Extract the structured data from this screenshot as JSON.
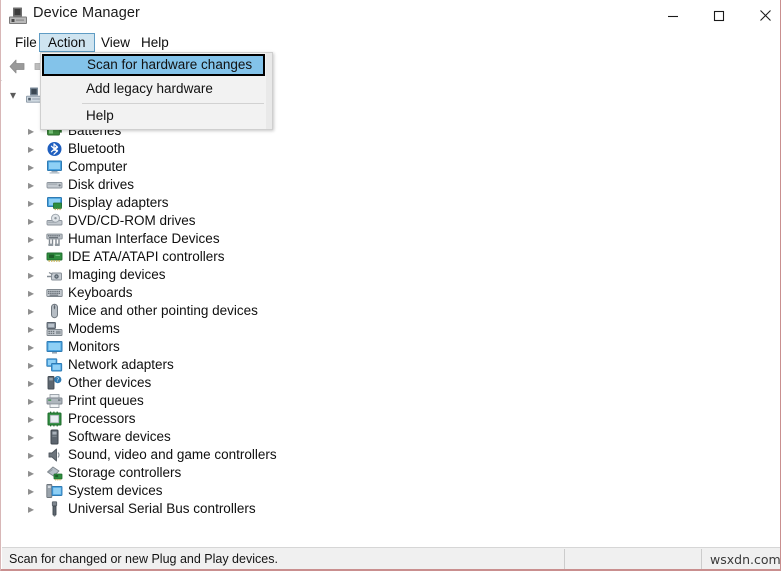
{
  "window": {
    "title": "Device Manager",
    "icon": "device-manager-icon",
    "controls": {
      "minimize": "—",
      "maximize": "☐",
      "close": "✕"
    }
  },
  "menubar": {
    "items": [
      {
        "label": "File",
        "active": false
      },
      {
        "label": "Action",
        "active": true
      },
      {
        "label": "View",
        "active": false
      },
      {
        "label": "Help",
        "active": false
      }
    ]
  },
  "toolbar": {
    "back_icon": "back-arrow-icon",
    "forward_icon": "forward-arrow-icon"
  },
  "action_menu": {
    "items": [
      {
        "label": "Scan for hardware changes",
        "highlighted": true
      },
      {
        "label": "Add legacy hardware",
        "highlighted": false
      },
      {
        "label": "Help",
        "highlighted": false
      }
    ],
    "highlight_color": "#83c3ea",
    "background_color": "#f2f2f2"
  },
  "tree": {
    "root": {
      "label": "",
      "icon": "computer-root-icon",
      "expanded": true
    },
    "items": [
      {
        "label": "Batteries",
        "icon": "battery-icon"
      },
      {
        "label": "Bluetooth",
        "icon": "bluetooth-icon"
      },
      {
        "label": "Computer",
        "icon": "computer-icon"
      },
      {
        "label": "Disk drives",
        "icon": "disk-drive-icon"
      },
      {
        "label": "Display adapters",
        "icon": "display-adapter-icon"
      },
      {
        "label": "DVD/CD-ROM drives",
        "icon": "dvd-drive-icon"
      },
      {
        "label": "Human Interface Devices",
        "icon": "hid-icon"
      },
      {
        "label": "IDE ATA/ATAPI controllers",
        "icon": "ide-controller-icon"
      },
      {
        "label": "Imaging devices",
        "icon": "imaging-device-icon"
      },
      {
        "label": "Keyboards",
        "icon": "keyboard-icon"
      },
      {
        "label": "Mice and other pointing devices",
        "icon": "mouse-icon"
      },
      {
        "label": "Modems",
        "icon": "modem-icon"
      },
      {
        "label": "Monitors",
        "icon": "monitor-icon"
      },
      {
        "label": "Network adapters",
        "icon": "network-adapter-icon"
      },
      {
        "label": "Other devices",
        "icon": "other-device-icon"
      },
      {
        "label": "Print queues",
        "icon": "printer-icon"
      },
      {
        "label": "Processors",
        "icon": "processor-icon"
      },
      {
        "label": "Software devices",
        "icon": "software-device-icon"
      },
      {
        "label": "Sound, video and game controllers",
        "icon": "sound-icon"
      },
      {
        "label": "Storage controllers",
        "icon": "storage-controller-icon"
      },
      {
        "label": "System devices",
        "icon": "system-device-icon"
      },
      {
        "label": "Universal Serial Bus controllers",
        "icon": "usb-icon"
      }
    ]
  },
  "statusbar": {
    "message": "Scan for changed or new Plug and Play devices.",
    "watermark": "wsxdn.com"
  }
}
